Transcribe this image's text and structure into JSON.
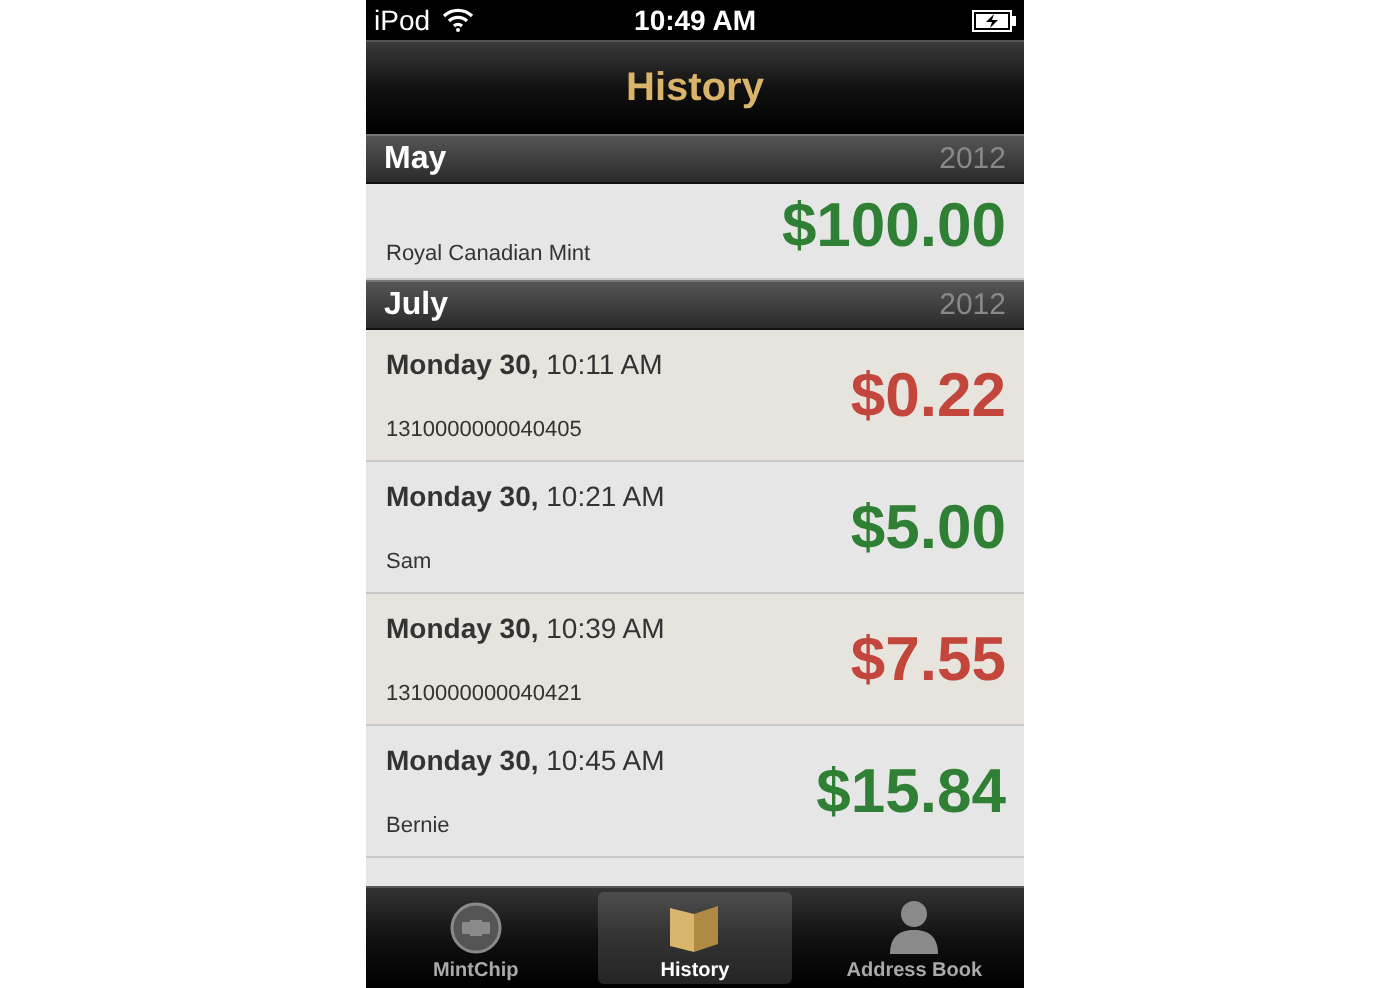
{
  "status_bar": {
    "carrier": "iPod",
    "time": "10:49 AM"
  },
  "nav": {
    "title": "History"
  },
  "sections": [
    {
      "month": "May",
      "year": "2012",
      "partial_first": true,
      "rows": [
        {
          "kind": "in",
          "amount": "$100.00",
          "party": "Royal Canadian Mint"
        }
      ]
    },
    {
      "month": "July",
      "year": "2012",
      "partial_first": false,
      "rows": [
        {
          "kind": "out",
          "day": "Monday 30,",
          "time": "10:11 AM",
          "amount": "$0.22",
          "party": "1310000000040405"
        },
        {
          "kind": "in",
          "day": "Monday 30,",
          "time": "10:21 AM",
          "amount": "$5.00",
          "party": "Sam"
        },
        {
          "kind": "out",
          "day": "Monday 30,",
          "time": "10:39 AM",
          "amount": "$7.55",
          "party": "1310000000040421"
        },
        {
          "kind": "in",
          "day": "Monday 30,",
          "time": "10:45 AM",
          "amount": "$15.84",
          "party": "Bernie"
        }
      ]
    }
  ],
  "tabs": [
    {
      "label": "MintChip",
      "selected": false
    },
    {
      "label": "History",
      "selected": true
    },
    {
      "label": "Address Book",
      "selected": false
    }
  ]
}
